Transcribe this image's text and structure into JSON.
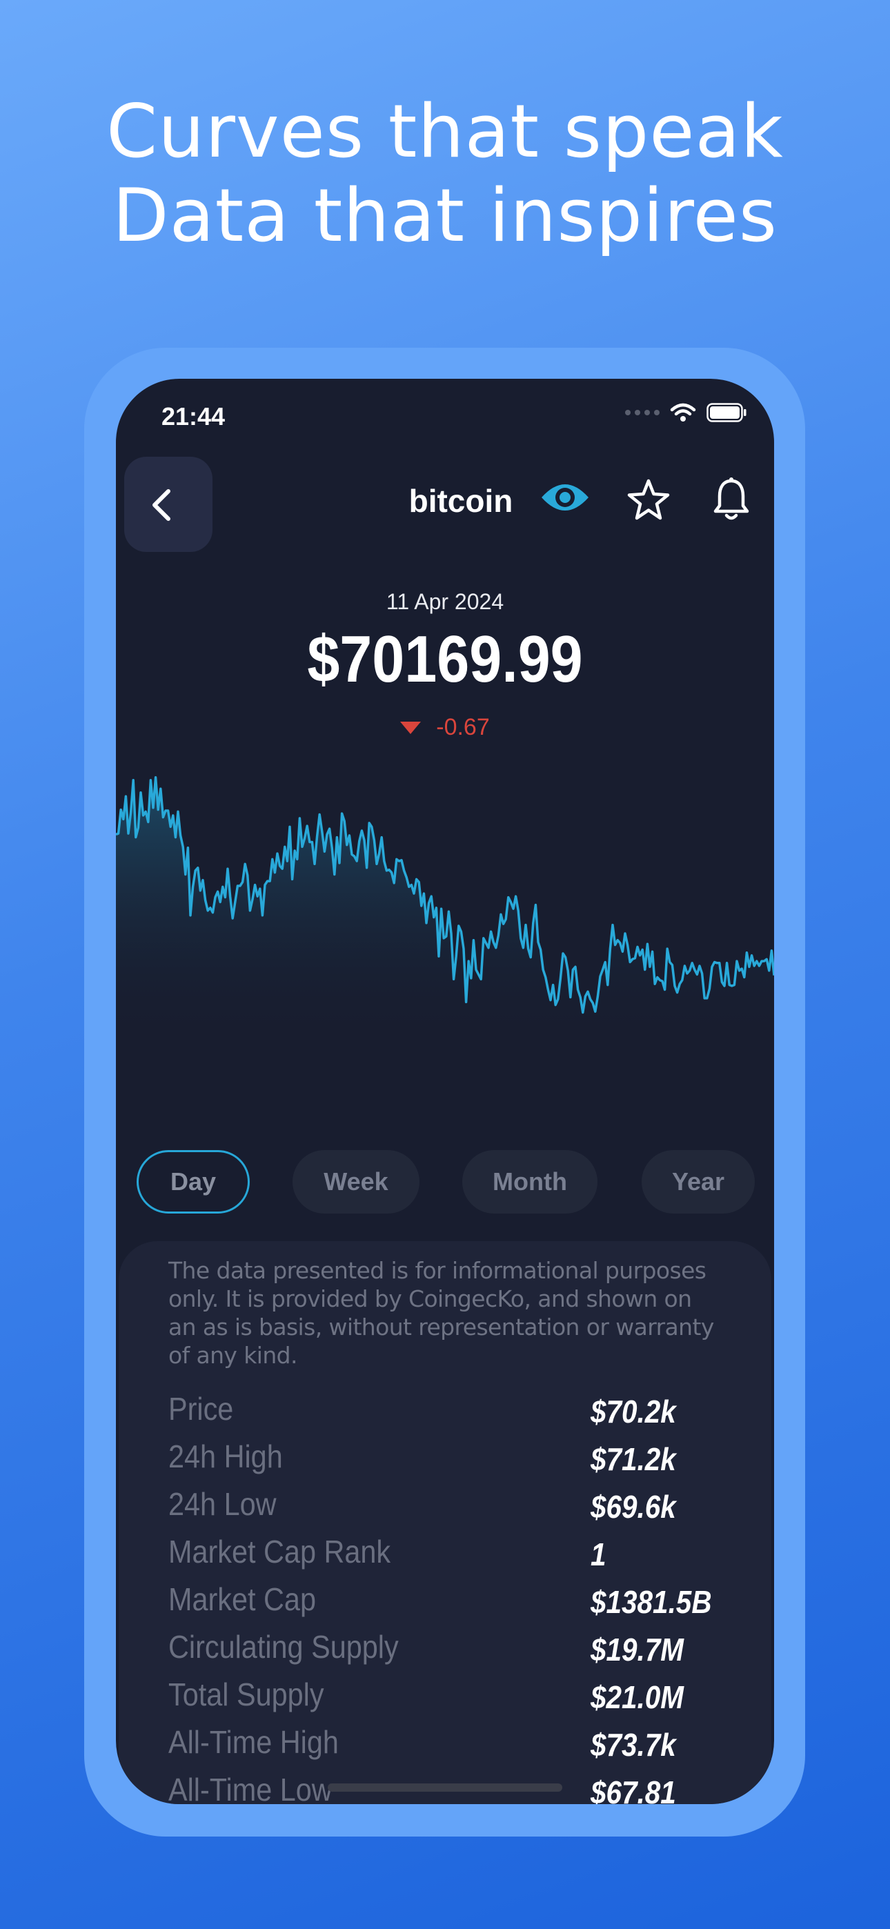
{
  "headline": {
    "line1": "Curves that speak",
    "line2": "Data that inspires"
  },
  "status_bar": {
    "time": "21:44"
  },
  "header": {
    "title": "bitcoin",
    "back_icon": "chevron-left-icon",
    "watch_icon": "eye-icon",
    "favorite_icon": "star-icon",
    "alert_icon": "bell-icon"
  },
  "price_block": {
    "date": "11 Apr 2024",
    "price": "$70169.99",
    "change": "-0.67",
    "change_color": "#d9453c"
  },
  "chart_data": {
    "type": "area",
    "line_color": "#29a9d9",
    "values": [
      708,
      709,
      734,
      724,
      748,
      709,
      731,
      765,
      705,
      715,
      752,
      728,
      732,
      721,
      765,
      736,
      768,
      734,
      756,
      726,
      733,
      733,
      716,
      728,
      705,
      732,
      707,
      695,
      666,
      694,
      623,
      653,
      670,
      673,
      649,
      660,
      639,
      628,
      631,
      626,
      642,
      648,
      637,
      653,
      642,
      672,
      643,
      620,
      637,
      654,
      654,
      658,
      677,
      665,
      628,
      640,
      655,
      643,
      651,
      623,
      655,
      659,
      659,
      682,
      668,
      688,
      675,
      672,
      695,
      680,
      716,
      661,
      691,
      682,
      725,
      695,
      704,
      717,
      700,
      700,
      677,
      706,
      729,
      711,
      690,
      708,
      714,
      694,
      666,
      705,
      678,
      730,
      722,
      697,
      707,
      687,
      685,
      680,
      701,
      712,
      702,
      673,
      720,
      716,
      702,
      677,
      688,
      705,
      680,
      670,
      671,
      668,
      657,
      682,
      680,
      681,
      670,
      663,
      653,
      655,
      646,
      661,
      658,
      633,
      646,
      615,
      636,
      643,
      621,
      631,
      580,
      630,
      599,
      601,
      627,
      604,
      556,
      580,
      612,
      606,
      588,
      532,
      575,
      557,
      597,
      566,
      561,
      556,
      599,
      594,
      589,
      606,
      595,
      589,
      602,
      624,
      614,
      619,
      642,
      637,
      630,
      643,
      628,
      599,
      589,
      613,
      588,
      579,
      615,
      634,
      595,
      587,
      566,
      558,
      545,
      534,
      550,
      529,
      535,
      557,
      583,
      579,
      565,
      537,
      566,
      569,
      545,
      537,
      521,
      538,
      543,
      535,
      531,
      522,
      538,
      559,
      566,
      574,
      550,
      588,
      613,
      592,
      597,
      594,
      585,
      604,
      592,
      574,
      577,
      578,
      590,
      581,
      587,
      566,
      593,
      569,
      585,
      551,
      558,
      555,
      554,
      545,
      588,
      574,
      571,
      549,
      542,
      551,
      555,
      570,
      562,
      565,
      573,
      566,
      561,
      570,
      562,
      536,
      536,
      546,
      569,
      574,
      573,
      573,
      553,
      549,
      573,
      550,
      549,
      550,
      575,
      565,
      567,
      558,
      584,
      569,
      581,
      570,
      575,
      570,
      575,
      575,
      577,
      565,
      586,
      560
    ],
    "ylim": [
      520,
      775
    ]
  },
  "ranges": [
    {
      "label": "Day",
      "active": true
    },
    {
      "label": "Week",
      "active": false
    },
    {
      "label": "Month",
      "active": false
    },
    {
      "label": "Year",
      "active": false
    }
  ],
  "disclaimer": "The data presented is for informational purposes only. It is provided by CoingecKo, and shown on an as is basis, without representation or warranty of any kind.",
  "stats": [
    {
      "label": "Price",
      "value": "$70.2k"
    },
    {
      "label": "24h High",
      "value": "$71.2k"
    },
    {
      "label": "24h Low",
      "value": "$69.6k"
    },
    {
      "label": "Market Cap Rank",
      "value": "1"
    },
    {
      "label": "Market Cap",
      "value": "$1381.5B"
    },
    {
      "label": "Circulating Supply",
      "value": "$19.7M"
    },
    {
      "label": "Total Supply",
      "value": "$21.0M"
    },
    {
      "label": "All-Time High",
      "value": "$73.7k"
    },
    {
      "label": "All-Time Low",
      "value": "$67.81"
    }
  ]
}
